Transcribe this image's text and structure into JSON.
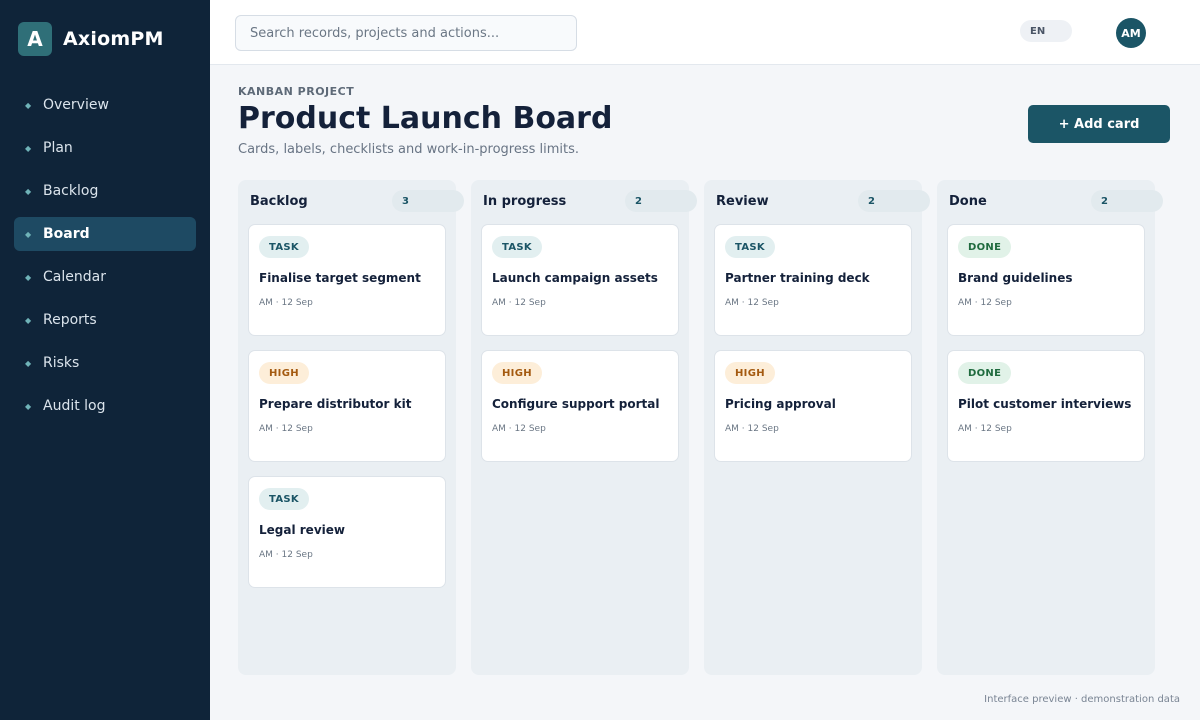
{
  "app": {
    "logo_letter": "A",
    "name": "AxiomPM"
  },
  "sidebar": {
    "items": [
      {
        "label": "Overview",
        "active": false
      },
      {
        "label": "Plan",
        "active": false
      },
      {
        "label": "Backlog",
        "active": false
      },
      {
        "label": "Board",
        "active": true
      },
      {
        "label": "Calendar",
        "active": false
      },
      {
        "label": "Reports",
        "active": false
      },
      {
        "label": "Risks",
        "active": false
      },
      {
        "label": "Audit log",
        "active": false
      }
    ]
  },
  "topbar": {
    "search_placeholder": "Search records, projects and actions...",
    "language": "EN",
    "avatar_initials": "AM"
  },
  "header": {
    "eyebrow": "KANBAN PROJECT",
    "title": "Product Launch Board",
    "subtitle": "Cards, labels, checklists and work-in-progress limits.",
    "add_button": "+ Add card"
  },
  "board": {
    "columns": [
      {
        "name": "Backlog",
        "count": "3",
        "cards": [
          {
            "tag": "TASK",
            "tag_type": "task",
            "title": "Finalise target segment",
            "meta": "AM · 12 Sep"
          },
          {
            "tag": "HIGH",
            "tag_type": "high",
            "title": "Prepare distributor kit",
            "meta": "AM · 12 Sep"
          },
          {
            "tag": "TASK",
            "tag_type": "task",
            "title": "Legal review",
            "meta": "AM · 12 Sep"
          }
        ]
      },
      {
        "name": "In progress",
        "count": "2",
        "cards": [
          {
            "tag": "TASK",
            "tag_type": "task",
            "title": "Launch campaign assets",
            "meta": "AM · 12 Sep"
          },
          {
            "tag": "HIGH",
            "tag_type": "high",
            "title": "Configure support portal",
            "meta": "AM · 12 Sep"
          }
        ]
      },
      {
        "name": "Review",
        "count": "2",
        "cards": [
          {
            "tag": "TASK",
            "tag_type": "task",
            "title": "Partner training deck",
            "meta": "AM · 12 Sep"
          },
          {
            "tag": "HIGH",
            "tag_type": "high",
            "title": "Pricing approval",
            "meta": "AM · 12 Sep"
          }
        ]
      },
      {
        "name": "Done",
        "count": "2",
        "cards": [
          {
            "tag": "DONE",
            "tag_type": "done",
            "title": "Brand guidelines",
            "meta": "AM · 12 Sep"
          },
          {
            "tag": "DONE",
            "tag_type": "done",
            "title": "Pilot customer interviews",
            "meta": "AM · 12 Sep"
          }
        ]
      }
    ]
  },
  "footer": {
    "note": "Interface preview · demonstration data"
  }
}
